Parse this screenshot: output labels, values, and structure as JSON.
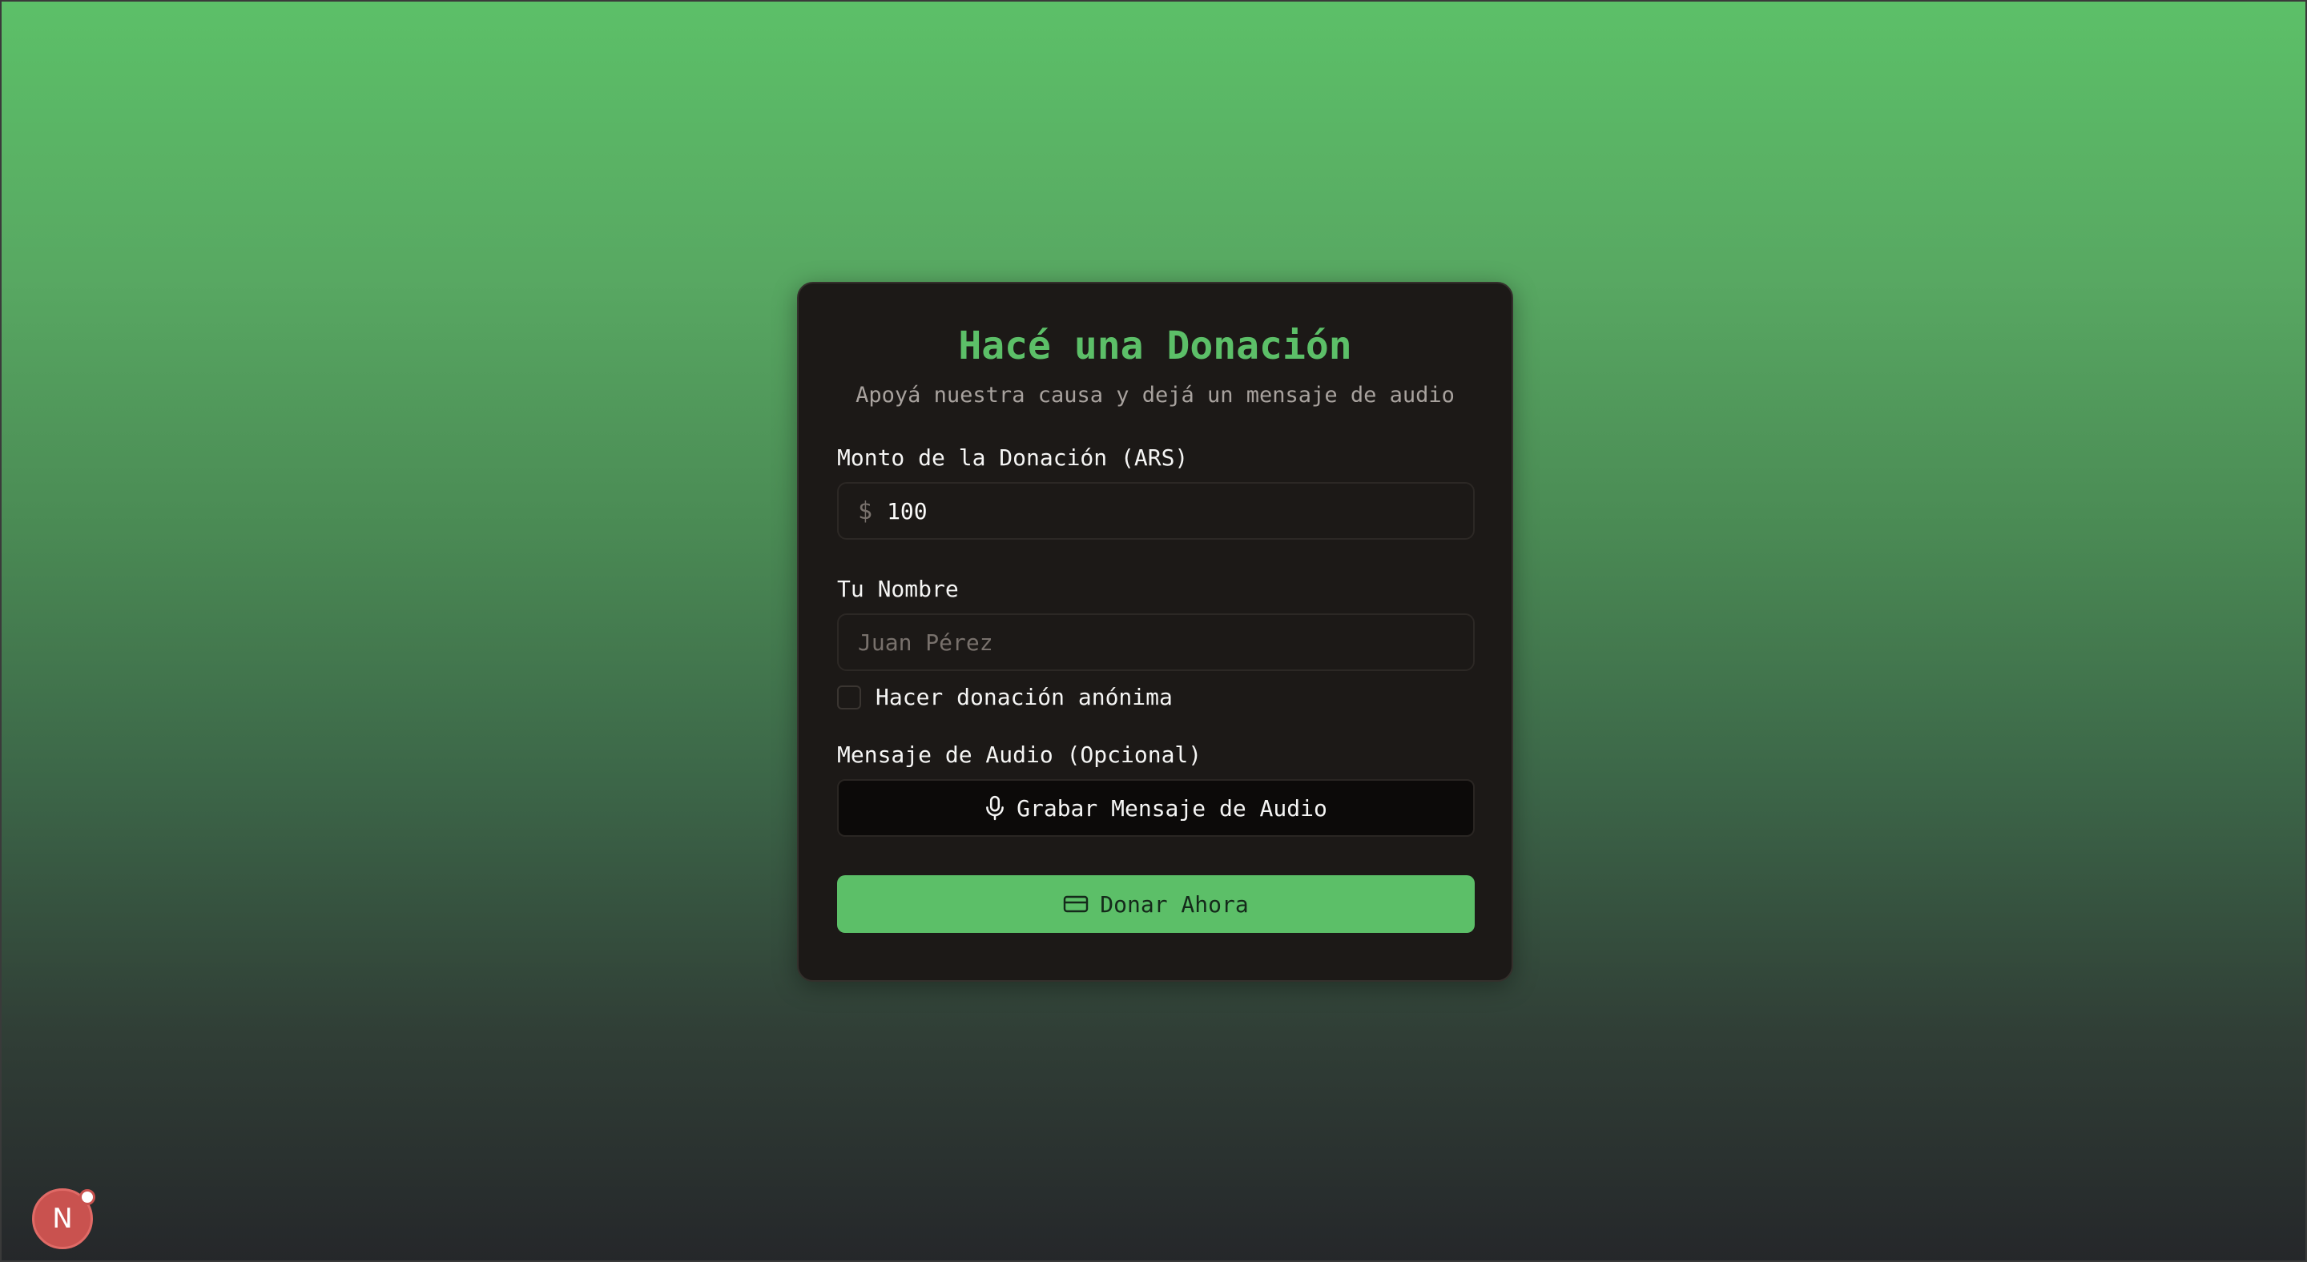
{
  "form": {
    "title": "Hacé una Donación",
    "subtitle": "Apoyá nuestra causa y dejá un mensaje de audio",
    "amount": {
      "label": "Monto de la Donación (ARS)",
      "currency_symbol": "$",
      "value": "100"
    },
    "name": {
      "label": "Tu Nombre",
      "placeholder": "Juan Pérez",
      "value": ""
    },
    "anonymous": {
      "label": "Hacer donación anónima",
      "checked": false
    },
    "audio": {
      "label": "Mensaje de Audio (Opcional)",
      "button_label": "Grabar Mensaje de Audio",
      "icon": "microphone-icon"
    },
    "submit": {
      "label": "Donar Ahora",
      "icon": "credit-card-icon"
    }
  },
  "dev_badge": {
    "letter": "N"
  },
  "colors": {
    "accent": "#5cbf68",
    "card_background": "#1c1917"
  }
}
